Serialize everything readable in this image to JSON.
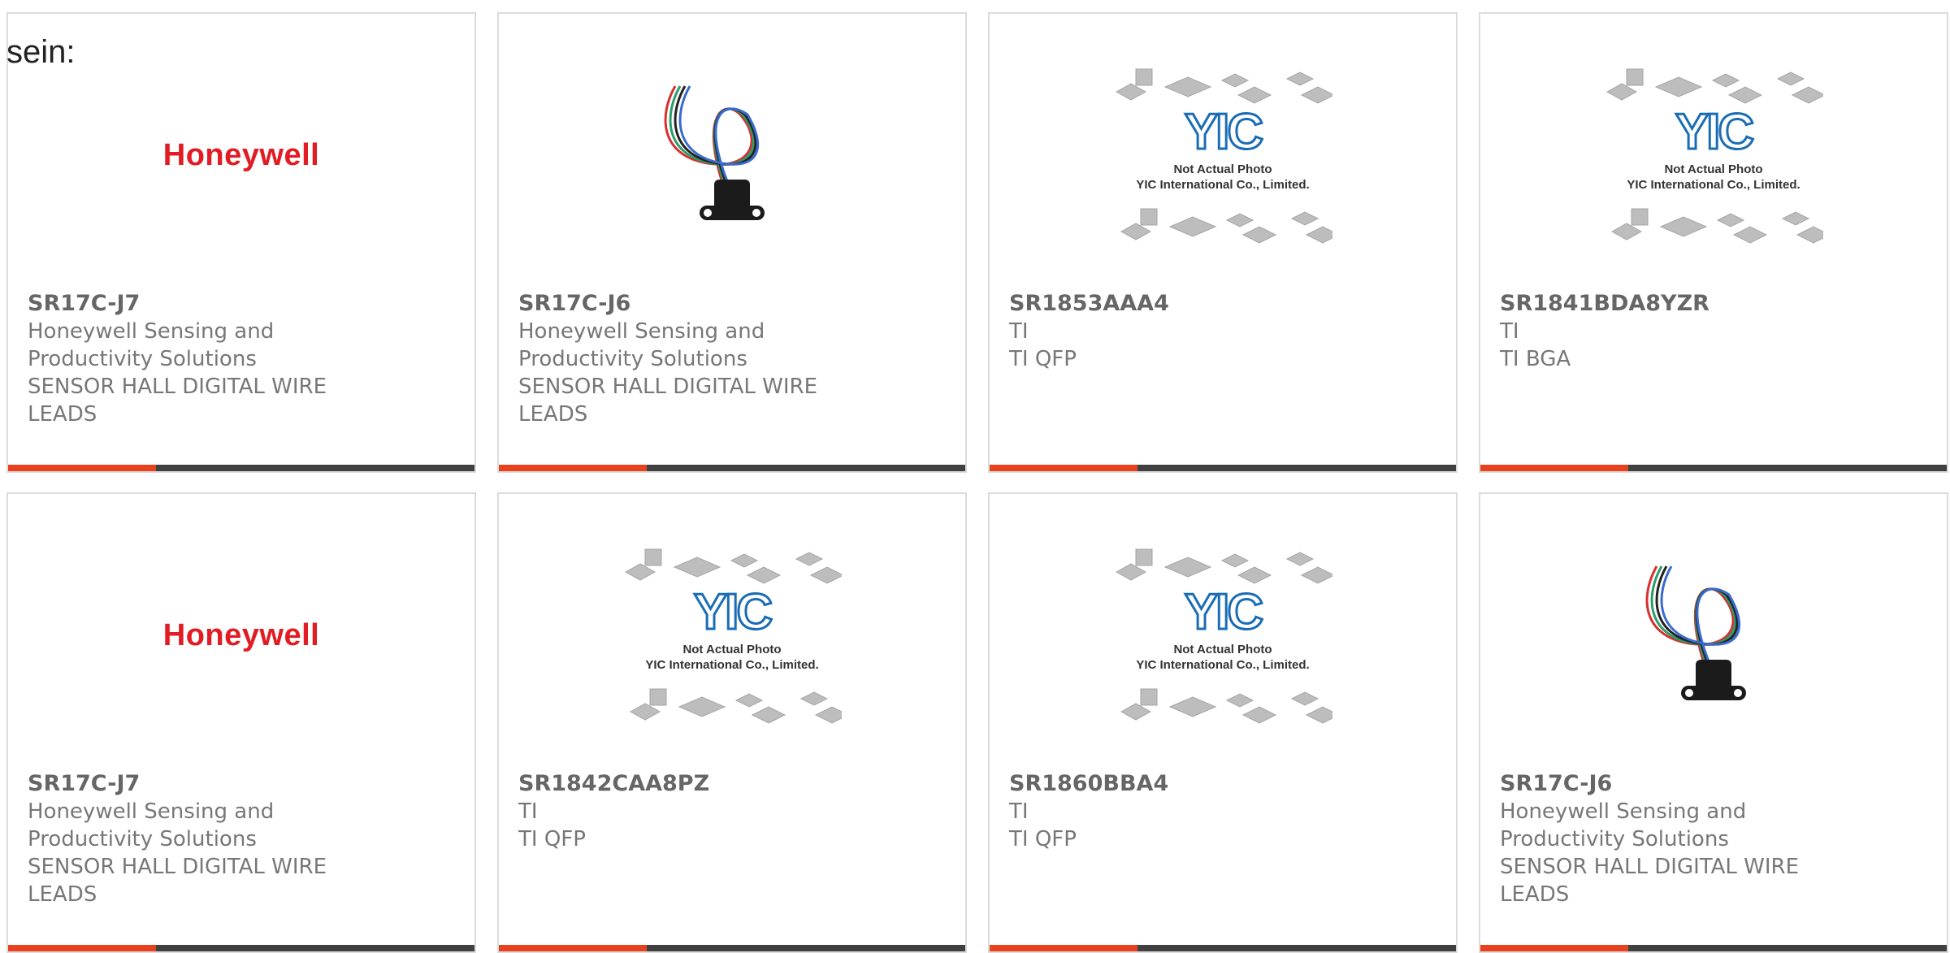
{
  "lead_text": "sein:",
  "colors": {
    "accent": "#e8411d",
    "bar": "#404040",
    "brand_red": "#e31b23",
    "yic_blue": "#1a6db5"
  },
  "cards": [
    {
      "part": "SR17C-J7",
      "lines": [
        "Honeywell Sensing and",
        "Productivity Solutions",
        "SENSOR HALL DIGITAL WIRE",
        "LEADS"
      ],
      "image": "honeywell-logo",
      "logo_text": "Honeywell"
    },
    {
      "part": "SR17C-J6",
      "lines": [
        "Honeywell Sensing and",
        "Productivity Solutions",
        "SENSOR HALL DIGITAL WIRE",
        "LEADS"
      ],
      "image": "sensor-photo"
    },
    {
      "part": "SR1853AAA4",
      "lines": [
        "TI",
        "TI QFP"
      ],
      "image": "yic-placeholder",
      "ph_logo": "YIC",
      "ph_line1": "Not Actual Photo",
      "ph_line2": "YIC International Co., Limited."
    },
    {
      "part": "SR1841BDA8YZR",
      "lines": [
        "TI",
        "TI BGA"
      ],
      "image": "yic-placeholder",
      "ph_logo": "YIC",
      "ph_line1": "Not Actual Photo",
      "ph_line2": "YIC International Co., Limited."
    },
    {
      "part": "SR17C-J7",
      "lines": [
        "Honeywell Sensing and",
        "Productivity Solutions",
        "SENSOR HALL DIGITAL WIRE",
        "LEADS"
      ],
      "image": "honeywell-logo",
      "logo_text": "Honeywell"
    },
    {
      "part": "SR1842CAA8PZ",
      "lines": [
        "TI",
        "TI QFP"
      ],
      "image": "yic-placeholder",
      "ph_logo": "YIC",
      "ph_line1": "Not Actual Photo",
      "ph_line2": "YIC International Co., Limited."
    },
    {
      "part": "SR1860BBA4",
      "lines": [
        "TI",
        "TI QFP"
      ],
      "image": "yic-placeholder",
      "ph_logo": "YIC",
      "ph_line1": "Not Actual Photo",
      "ph_line2": "YIC International Co., Limited."
    },
    {
      "part": "SR17C-J6",
      "lines": [
        "Honeywell Sensing and",
        "Productivity Solutions",
        "SENSOR HALL DIGITAL WIRE",
        "LEADS"
      ],
      "image": "sensor-photo"
    }
  ]
}
